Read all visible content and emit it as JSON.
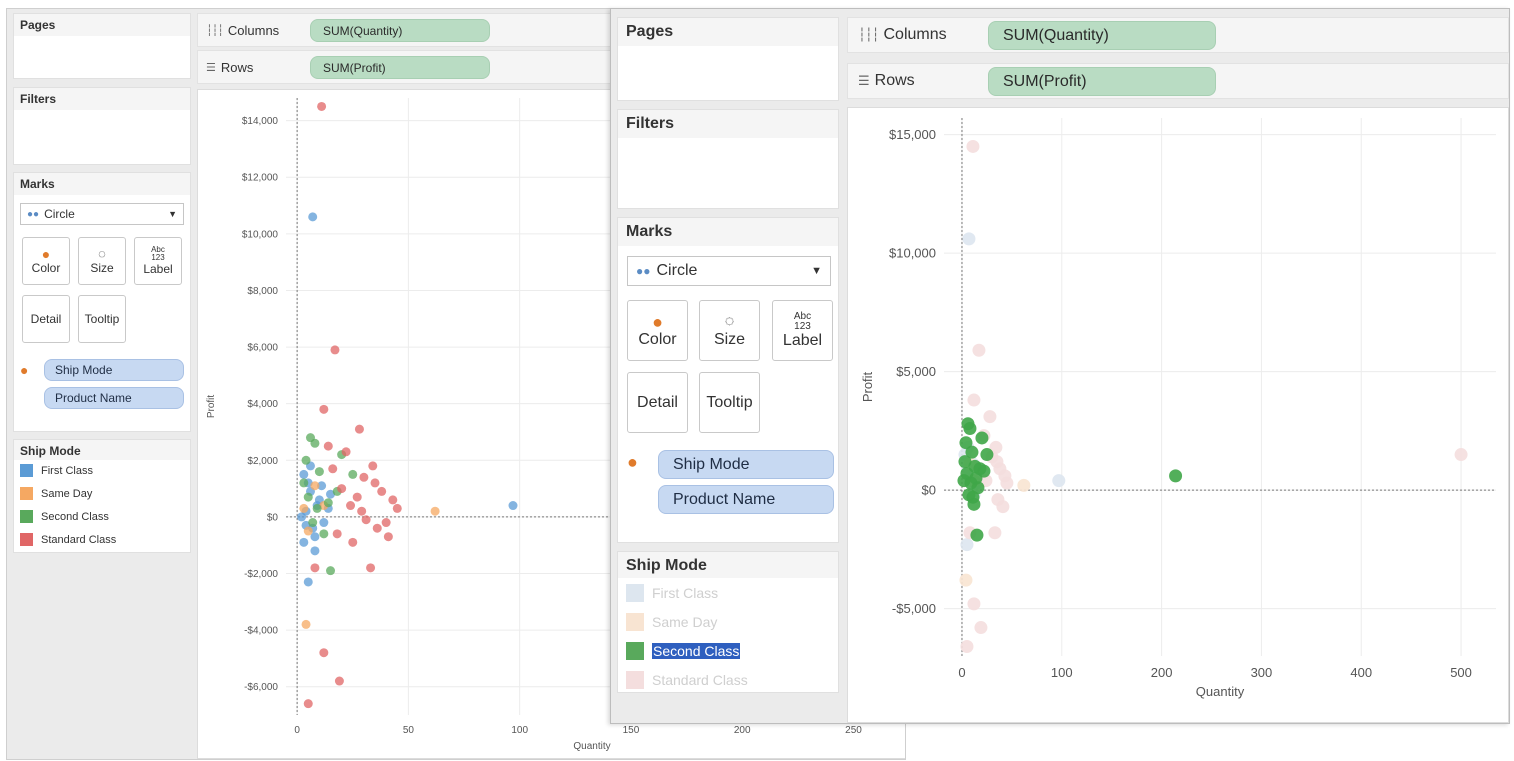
{
  "back": {
    "pages_title": "Pages",
    "filters_title": "Filters",
    "marks_title": "Marks",
    "mark_type": "Circle",
    "buttons": {
      "color": "Color",
      "size": "Size",
      "label": "Label",
      "detail": "Detail",
      "tooltip": "Tooltip",
      "label_glyph": "Abc\n123"
    },
    "mark_fields": [
      "Ship Mode",
      "Product Name"
    ],
    "columns_label": "Columns",
    "rows_label": "Rows",
    "columns_pill": "SUM(Quantity)",
    "rows_pill": "SUM(Profit)",
    "legend_title": "Ship Mode",
    "legend": [
      {
        "label": "First Class",
        "color": "#5b9bd5"
      },
      {
        "label": "Same Day",
        "color": "#f5a862"
      },
      {
        "label": "Second Class",
        "color": "#59a95c"
      },
      {
        "label": "Standard Class",
        "color": "#e06666"
      }
    ]
  },
  "front": {
    "pages_title": "Pages",
    "filters_title": "Filters",
    "marks_title": "Marks",
    "mark_type": "Circle",
    "buttons": {
      "color": "Color",
      "size": "Size",
      "label": "Label",
      "detail": "Detail",
      "tooltip": "Tooltip",
      "label_glyph": "Abc\n123"
    },
    "mark_fields": [
      "Ship Mode",
      "Product Name"
    ],
    "columns_label": "Columns",
    "rows_label": "Rows",
    "columns_pill": "SUM(Quantity)",
    "rows_pill": "SUM(Profit)",
    "legend_title": "Ship Mode",
    "legend": [
      {
        "label": "First Class",
        "color": "#dde6ef",
        "state": "faded"
      },
      {
        "label": "Same Day",
        "color": "#f8e4d2",
        "state": "faded"
      },
      {
        "label": "Second Class",
        "color": "#59a95c",
        "state": "selected"
      },
      {
        "label": "Standard Class",
        "color": "#f4dede",
        "state": "faded"
      }
    ]
  },
  "chart_data": [
    {
      "type": "scatter",
      "xlabel": "Quantity",
      "ylabel": "Profit",
      "xticks": [
        "0",
        "50",
        "100",
        "150",
        "200",
        "250"
      ],
      "yticks": [
        "-$6,000",
        "-$4,000",
        "-$2,000",
        "$0",
        "$2,000",
        "$4,000",
        "$6,000",
        "$8,000",
        "$10,000",
        "$12,000",
        "$14,000"
      ],
      "xlim": [
        -5,
        270
      ],
      "ylim": [
        -7000,
        14800
      ],
      "grid": true,
      "series": [
        {
          "name": "First Class",
          "color": "#5b9bd5",
          "points": [
            [
              7,
              10600
            ],
            [
              97,
              400
            ],
            [
              5,
              -2300
            ],
            [
              3,
              1500
            ],
            [
              6,
              900
            ],
            [
              9,
              400
            ],
            [
              4,
              -300
            ],
            [
              8,
              -700
            ],
            [
              11,
              1100
            ],
            [
              2,
              0
            ],
            [
              12,
              -200
            ],
            [
              6,
              1800
            ],
            [
              10,
              600
            ],
            [
              3,
              -900
            ],
            [
              14,
              300
            ],
            [
              5,
              1200
            ],
            [
              8,
              -1200
            ],
            [
              4,
              200
            ],
            [
              15,
              800
            ],
            [
              7,
              -400
            ]
          ]
        },
        {
          "name": "Same Day",
          "color": "#f5a862",
          "points": [
            [
              62,
              200
            ],
            [
              4,
              -3800
            ],
            [
              8,
              1100
            ],
            [
              5,
              -500
            ],
            [
              12,
              400
            ],
            [
              3,
              300
            ]
          ]
        },
        {
          "name": "Second Class",
          "color": "#59a95c",
          "points": [
            [
              214,
              600
            ],
            [
              6,
              2800
            ],
            [
              8,
              2600
            ],
            [
              15,
              -1900
            ],
            [
              10,
              1600
            ],
            [
              5,
              700
            ],
            [
              20,
              2200
            ],
            [
              12,
              -600
            ],
            [
              3,
              1200
            ],
            [
              9,
              300
            ],
            [
              18,
              900
            ],
            [
              7,
              -200
            ],
            [
              25,
              1500
            ],
            [
              14,
              500
            ],
            [
              4,
              2000
            ]
          ]
        },
        {
          "name": "Standard Class",
          "color": "#e06666",
          "points": [
            [
              11,
              14500
            ],
            [
              17,
              5900
            ],
            [
              12,
              3800
            ],
            [
              28,
              3100
            ],
            [
              22,
              2300
            ],
            [
              34,
              1800
            ],
            [
              30,
              1400
            ],
            [
              20,
              1000
            ],
            [
              38,
              900
            ],
            [
              43,
              600
            ],
            [
              36,
              -400
            ],
            [
              25,
              -900
            ],
            [
              40,
              -200
            ],
            [
              33,
              -1800
            ],
            [
              8,
              -1800
            ],
            [
              12,
              -4800
            ],
            [
              19,
              -5800
            ],
            [
              5,
              -6600
            ],
            [
              27,
              700
            ],
            [
              45,
              300
            ],
            [
              16,
              1700
            ],
            [
              31,
              -100
            ],
            [
              24,
              400
            ],
            [
              18,
              -600
            ],
            [
              35,
              1200
            ],
            [
              41,
              -700
            ],
            [
              29,
              200
            ],
            [
              14,
              2500
            ]
          ]
        }
      ]
    },
    {
      "type": "scatter",
      "xlabel": "Quantity",
      "ylabel": "Profit",
      "xticks": [
        "0",
        "100",
        "200",
        "300",
        "400",
        "500"
      ],
      "yticks": [
        "-$5,000",
        "$0",
        "$5,000",
        "$10,000",
        "$15,000"
      ],
      "xlim": [
        -18,
        535
      ],
      "ylim": [
        -7000,
        15700
      ],
      "grid": true,
      "highlighted_series": "Second Class",
      "series": [
        {
          "name": "First Class",
          "color": "#dde6ef",
          "points": [
            [
              7,
              10600
            ],
            [
              97,
              400
            ],
            [
              5,
              -2300
            ],
            [
              3,
              1500
            ],
            [
              6,
              900
            ],
            [
              9,
              400
            ],
            [
              11,
              1100
            ],
            [
              12,
              -200
            ],
            [
              6,
              1800
            ],
            [
              14,
              300
            ]
          ]
        },
        {
          "name": "Same Day",
          "color": "#f8e4d2",
          "points": [
            [
              62,
              200
            ],
            [
              4,
              -3800
            ],
            [
              8,
              1100
            ],
            [
              12,
              400
            ]
          ]
        },
        {
          "name": "Standard Class",
          "color": "#f4dede",
          "points": [
            [
              500,
              1500
            ],
            [
              11,
              14500
            ],
            [
              17,
              5900
            ],
            [
              12,
              3800
            ],
            [
              28,
              3100
            ],
            [
              22,
              2300
            ],
            [
              34,
              1800
            ],
            [
              30,
              1400
            ],
            [
              38,
              900
            ],
            [
              43,
              600
            ],
            [
              36,
              -400
            ],
            [
              33,
              -1800
            ],
            [
              8,
              -1800
            ],
            [
              12,
              -4800
            ],
            [
              19,
              -5800
            ],
            [
              5,
              -6600
            ],
            [
              45,
              300
            ],
            [
              41,
              -700
            ],
            [
              35,
              1200
            ],
            [
              24,
              400
            ]
          ]
        },
        {
          "name": "Second Class",
          "color": "#3fa648",
          "points": [
            [
              214,
              600
            ],
            [
              6,
              2800
            ],
            [
              8,
              2600
            ],
            [
              15,
              -1900
            ],
            [
              10,
              1600
            ],
            [
              5,
              700
            ],
            [
              20,
              2200
            ],
            [
              12,
              -600
            ],
            [
              3,
              1200
            ],
            [
              9,
              300
            ],
            [
              18,
              900
            ],
            [
              7,
              -200
            ],
            [
              25,
              1500
            ],
            [
              14,
              500
            ],
            [
              4,
              2000
            ],
            [
              16,
              100
            ],
            [
              11,
              -300
            ],
            [
              2,
              400
            ],
            [
              22,
              800
            ],
            [
              13,
              1000
            ]
          ]
        }
      ]
    }
  ]
}
